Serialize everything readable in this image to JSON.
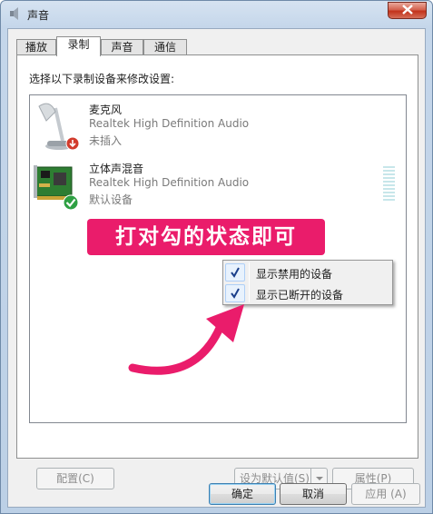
{
  "window": {
    "title": "声音"
  },
  "tabs": [
    {
      "label": "播放",
      "active": false
    },
    {
      "label": "录制",
      "active": true
    },
    {
      "label": "声音",
      "active": false
    },
    {
      "label": "通信",
      "active": false
    }
  ],
  "panel": {
    "instructions": "选择以下录制设备来修改设置:"
  },
  "devices": [
    {
      "name": "麦克风",
      "driver": "Realtek High Definition Audio",
      "status": "未插入",
      "icon": "microphone-icon",
      "badge": "unplugged-badge-icon"
    },
    {
      "name": "立体声混音",
      "driver": "Realtek High Definition Audio",
      "status": "默认设备",
      "icon": "sound-card-icon",
      "badge": "default-checkmark-icon"
    }
  ],
  "annotation": {
    "text": "打对勾的状态即可",
    "color": "#ea1c6b"
  },
  "context_menu": {
    "items": [
      {
        "label": "显示禁用的设备",
        "checked": true
      },
      {
        "label": "显示已断开的设备",
        "checked": true
      }
    ]
  },
  "panel_buttons": {
    "configure": "配置(C)",
    "set_default": "设为默认值(S)",
    "properties": "属性(P)"
  },
  "dialog_buttons": {
    "ok": "确定",
    "cancel": "取消",
    "apply": "应用 (A)"
  }
}
